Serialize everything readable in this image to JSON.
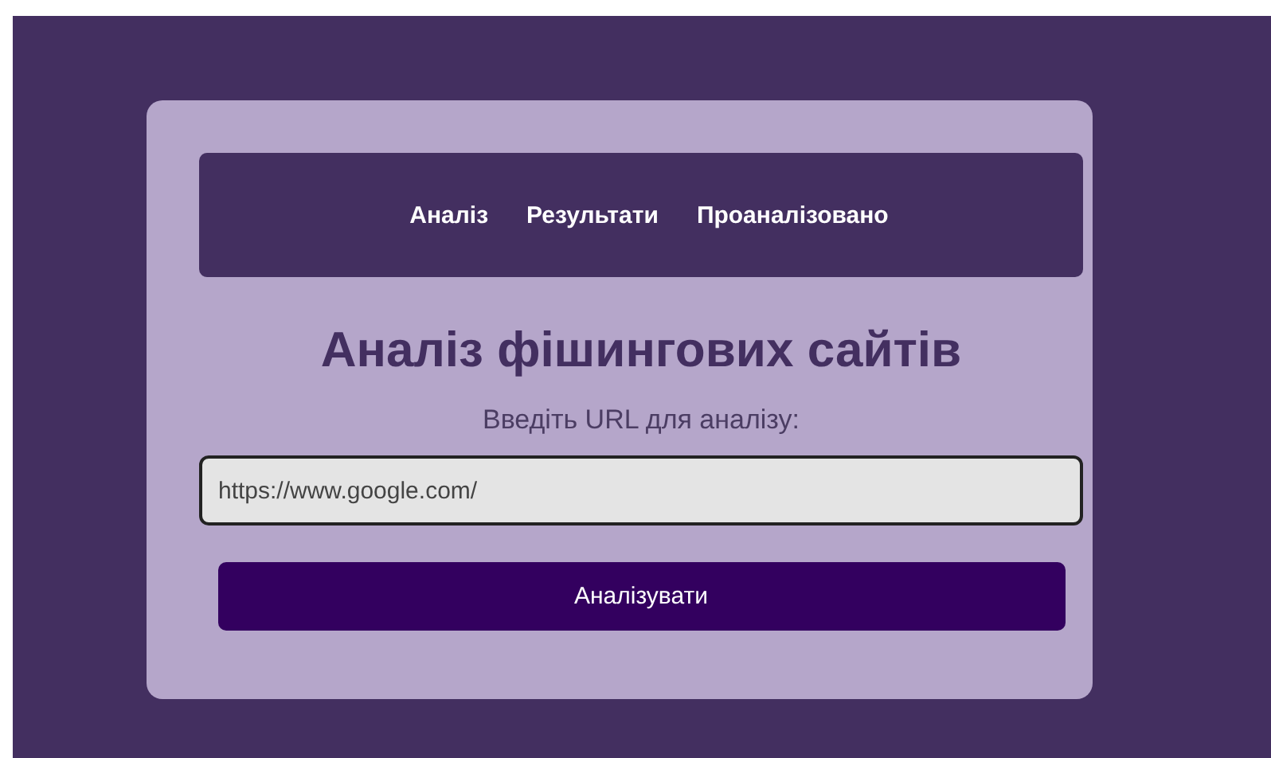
{
  "nav": {
    "links": [
      {
        "label": "Аналіз"
      },
      {
        "label": "Результати"
      },
      {
        "label": "Проаналізовано"
      }
    ]
  },
  "title": "Аналіз фішингових сайтів",
  "url_label": "Введіть URL для аналізу:",
  "url_field": {
    "value": "https://www.google.com/"
  },
  "submit_button": "Аналізувати"
}
